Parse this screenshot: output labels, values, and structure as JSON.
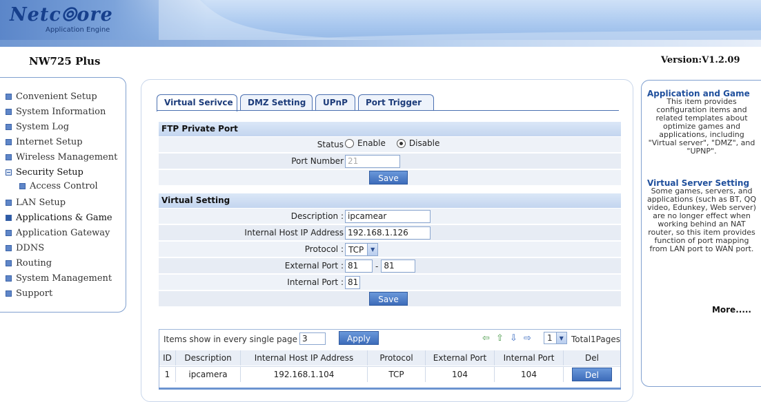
{
  "header": {
    "logo_main": "Netc⦾ore",
    "logo_sub": "Application Engine",
    "model": "NW725 Plus",
    "version": "Version:V1.2.09"
  },
  "sidebar": {
    "items": [
      {
        "label": "Convenient Setup",
        "icon": "square-icon"
      },
      {
        "label": "System Information",
        "icon": "square-icon"
      },
      {
        "label": "System Log",
        "icon": "square-icon"
      },
      {
        "label": "Internet Setup",
        "icon": "square-icon"
      },
      {
        "label": "Wireless Management",
        "icon": "square-icon"
      },
      {
        "label": "Security Setup",
        "icon": "minus-square-icon"
      },
      {
        "label": "Access Control",
        "icon": "square-icon"
      },
      {
        "label": "LAN Setup",
        "icon": "square-icon"
      },
      {
        "label": "Applications & Game",
        "icon": "arrow-right-icon"
      },
      {
        "label": "Application Gateway",
        "icon": "square-icon"
      },
      {
        "label": "DDNS",
        "icon": "square-icon"
      },
      {
        "label": "Routing",
        "icon": "square-icon"
      },
      {
        "label": "System Management",
        "icon": "square-icon"
      },
      {
        "label": "Support",
        "icon": "square-icon"
      }
    ]
  },
  "tabs": [
    {
      "label": "Virtual Serivce",
      "active": true
    },
    {
      "label": "DMZ Setting",
      "active": false
    },
    {
      "label": "UPnP",
      "active": false
    },
    {
      "label": "Port Trigger",
      "active": false
    }
  ],
  "ftp": {
    "title": "FTP Private Port",
    "status_label": "Status",
    "enable_label": "Enable",
    "disable_label": "Disable",
    "selected": "Disable",
    "port_label": "Port Number",
    "port_value": "21",
    "save_label": "Save"
  },
  "virtual": {
    "title": "Virtual Setting",
    "description_label": "Description :",
    "description_value": "ipcamear",
    "host_label": "Internal Host IP Address",
    "host_value": "192.168.1.126",
    "protocol_label": "Protocol :",
    "protocol_value": "TCP",
    "external_label": "External Port :",
    "external_from": "81",
    "dash": "- ",
    "external_to": "81",
    "internal_label": "Internal Port :",
    "internal_value": "81",
    "save_label": "Save"
  },
  "list": {
    "items_label": "Items show in every single page",
    "items_value": "3",
    "apply_label": "Apply",
    "page_value": "1",
    "total_label": "Total1Pages",
    "columns": [
      "ID",
      "Description",
      "Internal Host IP Address",
      "Protocol",
      "External Port",
      "Internal Port",
      "Del"
    ],
    "rows": [
      {
        "id": "1",
        "description": "ipcamera",
        "host": "192.168.1.104",
        "protocol": "TCP",
        "external": "104",
        "internal": "104",
        "del_label": "Del"
      }
    ]
  },
  "help": {
    "title1": "Application and Game",
    "body1": "This item provides configuration items and related templates about optimize games and applications, including \"Virtual server\", \"DMZ\", and \"UPNP\".",
    "title2": "Virtual Server Setting",
    "body2": "Some games, servers, and applications (such as BT, QQ video, Edunkey, Web server) are no longer effect when working behind an NAT router, so this item provides function of port mapping from LAN port to WAN port.",
    "more_label": "More....."
  },
  "colors": {
    "brand_blue": "#1d3c7a",
    "button_blue": "#3d6cba",
    "help_title": "#1f4f9c"
  }
}
